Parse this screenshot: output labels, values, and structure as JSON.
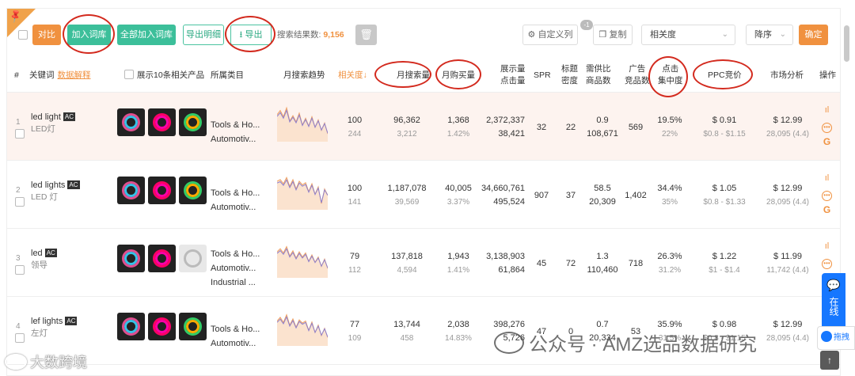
{
  "toolbar": {
    "compare_label": "对比",
    "add_to_lib_label": "加入词库",
    "add_all_label": "全部加入词库",
    "export_detail_label": "导出明细",
    "export_label": "导出",
    "search_results_label": "搜索结果数:",
    "search_results_count": "9,156",
    "custom_columns_label": "自定义列",
    "custom_columns_badge": "-1",
    "copy_label": "复制",
    "sort_field": "相关度",
    "sort_order": "降序",
    "confirm_label": "确定"
  },
  "header": {
    "index": "#",
    "keyword": "关键词",
    "keyword_explain": "数据解释",
    "show_products": "展示10条相关产品",
    "category": "所属类目",
    "trend": "月搜索趋势",
    "relevance": "相关度",
    "monthly_search": "月搜索量",
    "monthly_purchase": "月购买量",
    "impressions_1": "展示量",
    "impressions_2": "点击量",
    "spr": "SPR",
    "title_density_1": "标题",
    "title_density_2": "密度",
    "supply_1": "需供比",
    "supply_2": "商品数",
    "ads_1": "广告",
    "ads_2": "竞品数",
    "click_conc_1": "点击",
    "click_conc_2": "集中度",
    "ppc": "PPC竞价",
    "market": "市场分析",
    "ops": "操作"
  },
  "rows": [
    {
      "num": "1",
      "keyword": "led light",
      "tag": "AC",
      "translation": "LED灯",
      "categories": [
        "Tools & Ho...",
        "Automotiv..."
      ],
      "relevance": "100",
      "relevance_sub": "244",
      "monthly_search": "96,362",
      "monthly_search_sub": "3,212",
      "purchase": "1,368",
      "purchase_rate": "1.42%",
      "impressions": "2,372,337",
      "clicks": "38,421",
      "spr": "32",
      "title_density": "22",
      "supply_ratio": "0.9",
      "products": "108,671",
      "ads": "569",
      "click_conc": "19.5%",
      "click_conc_sub": "22%",
      "ppc": "$ 0.91",
      "ppc_range": "$0.8 - $1.15",
      "price": "$ 12.99",
      "reviews": "28,095 (4.4)",
      "trend": [
        52,
        60,
        48,
        65,
        40,
        50,
        38,
        55,
        32,
        45,
        30,
        48,
        28,
        42,
        22,
        36,
        15
      ]
    },
    {
      "num": "2",
      "keyword": "led lights",
      "tag": "AC",
      "translation": "LED 灯",
      "categories": [
        "Tools & Ho...",
        "Automotiv..."
      ],
      "relevance": "100",
      "relevance_sub": "141",
      "monthly_search": "1,187,078",
      "monthly_search_sub": "39,569",
      "purchase": "40,005",
      "purchase_rate": "3.37%",
      "impressions": "34,660,761",
      "clicks": "495,524",
      "spr": "907",
      "title_density": "37",
      "supply_ratio": "58.5",
      "products": "20,309",
      "ads": "1,402",
      "click_conc": "34.4%",
      "click_conc_sub": "35%",
      "ppc": "$ 1.05",
      "ppc_range": "$0.8 - $1.33",
      "price": "$ 12.99",
      "reviews": "28,095 (4.4)",
      "trend": [
        55,
        58,
        50,
        62,
        45,
        58,
        40,
        55,
        48,
        52,
        35,
        50,
        30,
        44,
        12,
        40,
        28
      ]
    },
    {
      "num": "3",
      "keyword": "led",
      "tag": "AC",
      "translation": "领导",
      "categories": [
        "Tools & Ho...",
        "Automotiv...",
        "Industrial ..."
      ],
      "relevance": "79",
      "relevance_sub": "112",
      "monthly_search": "137,818",
      "monthly_search_sub": "4,594",
      "purchase": "1,943",
      "purchase_rate": "1.41%",
      "impressions": "3,138,903",
      "clicks": "61,864",
      "spr": "45",
      "title_density": "72",
      "supply_ratio": "1.3",
      "products": "110,460",
      "ads": "718",
      "click_conc": "26.3%",
      "click_conc_sub": "31.2%",
      "ppc": "$ 1.22",
      "ppc_range": "$1 - $1.4",
      "price": "$ 11.99",
      "reviews": "11,742 (4.4)",
      "trend": [
        50,
        56,
        48,
        60,
        42,
        52,
        38,
        50,
        40,
        48,
        32,
        44,
        30,
        40,
        22,
        36,
        18
      ]
    },
    {
      "num": "4",
      "keyword": "lef lights",
      "tag": "AC",
      "translation": "左灯",
      "categories": [
        "Tools & Ho...",
        "Automotiv..."
      ],
      "relevance": "77",
      "relevance_sub": "109",
      "monthly_search": "13,744",
      "monthly_search_sub": "458",
      "purchase": "2,038",
      "purchase_rate": "14.83%",
      "impressions": "398,276",
      "clicks": "5,726",
      "spr": "47",
      "title_density": "0",
      "supply_ratio": "0.7",
      "products": "20,334",
      "ads": "53",
      "click_conc": "35.9%",
      "click_conc_sub": "31.5%",
      "ppc": "$ 0.98",
      "ppc_range": "$0.8 - $1.15",
      "price": "$ 12.99",
      "reviews": "28,095 (4.4)",
      "trend": [
        48,
        55,
        45,
        60,
        40,
        52,
        36,
        50,
        44,
        48,
        30,
        46,
        26,
        40,
        20,
        34,
        16
      ]
    }
  ],
  "side": {
    "online_label": "在线",
    "drag_label": "拖拽"
  },
  "watermark": {
    "right": "公众号 · AMZ选品数据研究",
    "left": "大数跨境"
  },
  "colors": {
    "accent": "#f0913f",
    "green": "#3cbf9a",
    "annotation": "#d32a1e",
    "highlight_row": "#fdf3ef"
  }
}
